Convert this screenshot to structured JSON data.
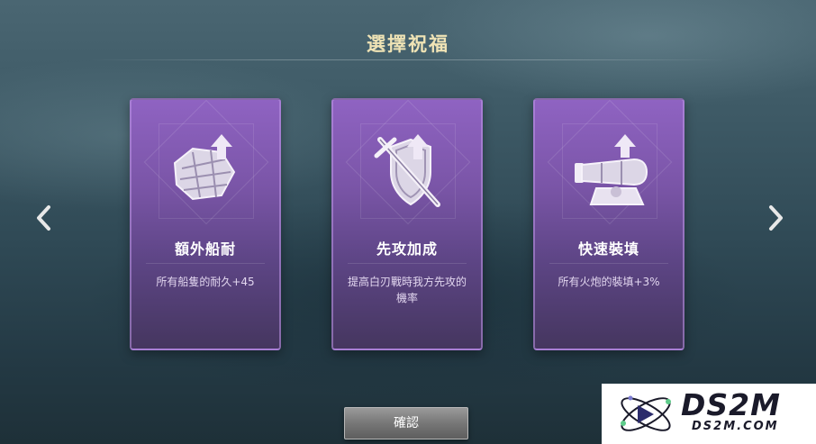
{
  "title": "選擇祝福",
  "cards": [
    {
      "name": "額外船耐",
      "description": "所有船隻的耐久+45",
      "icon": "hull-plank-upgrade-icon"
    },
    {
      "name": "先攻加成",
      "description": "提高白刃戰時我方先攻的機率",
      "icon": "sword-shield-upgrade-icon"
    },
    {
      "name": "快速裝填",
      "description": "所有火炮的裝填+3%",
      "icon": "cannon-upgrade-icon"
    }
  ],
  "nav": {
    "prev_icon": "chevron-left-icon",
    "next_icon": "chevron-right-icon"
  },
  "confirm_label": "確認",
  "watermark": {
    "main": "DS2M",
    "sub": "DS2M.COM"
  },
  "colors": {
    "title": "#efe3b5",
    "card": "#7a55a7",
    "button": "#777777"
  }
}
